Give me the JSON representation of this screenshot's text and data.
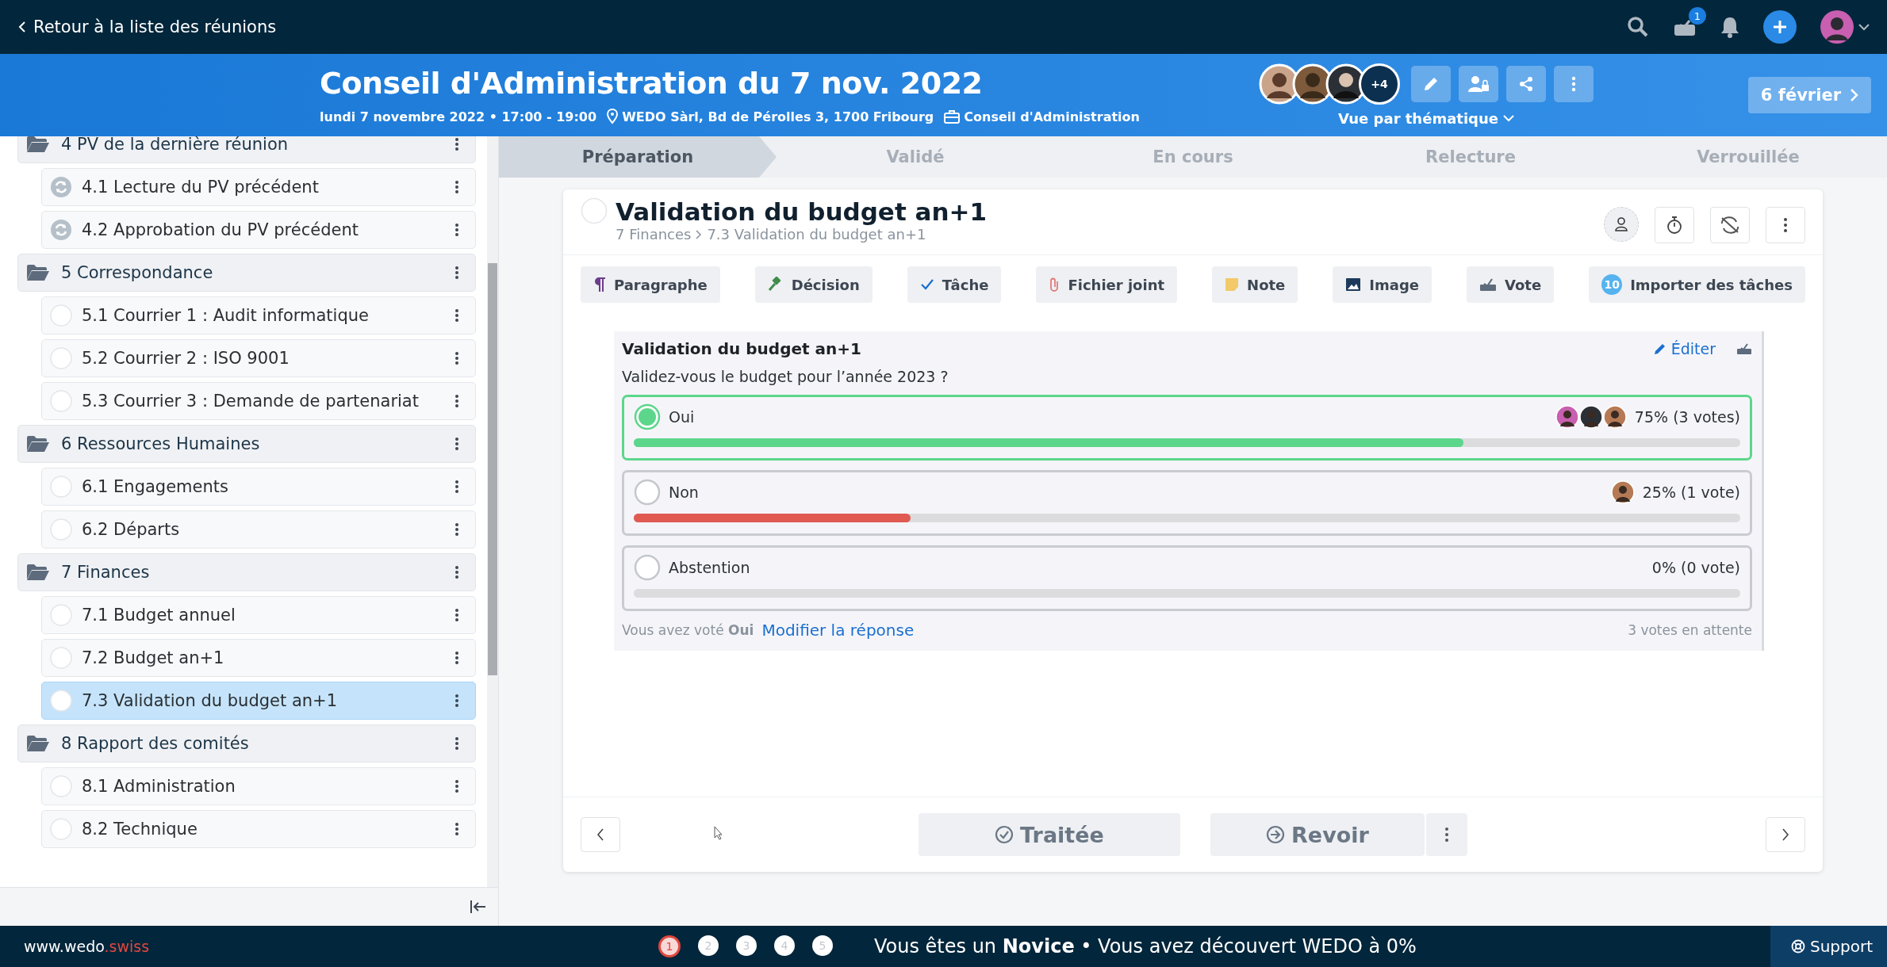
{
  "topbar": {
    "back_link": "Retour à la liste des réunions",
    "notification_badge": "1"
  },
  "meeting": {
    "title": "Conseil d'Administration du 7 nov. 2022",
    "date": "lundi 7 novembre 2022 • 17:00 - 19:00",
    "location": "WEDO Sàrl, Bd de Pérolles 3, 1700 Fribourg",
    "organization": "Conseil d'Administration",
    "participants_more": "+4",
    "view_selector": "Vue par thématique",
    "next_meeting": "6 février"
  },
  "sidebar": {
    "sections": [
      {
        "label": "4 PV de la dernière réunion",
        "children": [
          {
            "label": "4.1 Lecture du PV précédent",
            "kind": "recurring",
            "selected": false
          },
          {
            "label": "4.2 Approbation du PV précédent",
            "kind": "recurring",
            "selected": false
          }
        ]
      },
      {
        "label": "5 Correspondance",
        "children": [
          {
            "label": "5.1 Courrier 1 : Audit informatique",
            "kind": "open",
            "selected": false
          },
          {
            "label": "5.2 Courrier 2 : ISO 9001",
            "kind": "open",
            "selected": false
          },
          {
            "label": "5.3 Courrier 3 : Demande de partenariat",
            "kind": "open",
            "selected": false
          }
        ]
      },
      {
        "label": "6 Ressources Humaines",
        "children": [
          {
            "label": "6.1 Engagements",
            "kind": "open",
            "selected": false
          },
          {
            "label": "6.2 Départs",
            "kind": "open",
            "selected": false
          }
        ]
      },
      {
        "label": "7 Finances",
        "children": [
          {
            "label": "7.1 Budget annuel",
            "kind": "open",
            "selected": false
          },
          {
            "label": "7.2 Budget an+1",
            "kind": "open",
            "selected": false
          },
          {
            "label": "7.3 Validation du budget an+1",
            "kind": "open",
            "selected": true
          }
        ]
      },
      {
        "label": "8 Rapport des comités",
        "children": [
          {
            "label": "8.1 Administration",
            "kind": "open",
            "selected": false
          },
          {
            "label": "8.2 Technique",
            "kind": "open",
            "selected": false
          }
        ]
      }
    ]
  },
  "steps": [
    {
      "label": "Préparation",
      "selected": true
    },
    {
      "label": "Validé",
      "selected": false
    },
    {
      "label": "En cours",
      "selected": false
    },
    {
      "label": "Relecture",
      "selected": false
    },
    {
      "label": "Verrouillée",
      "selected": false
    }
  ],
  "topic": {
    "title": "Validation du budget an+1",
    "breadcrumb": [
      "7 Finances",
      "7.3 Validation du budget an+1"
    ],
    "tools": [
      {
        "label": "Paragraphe",
        "kind": "paragraph"
      },
      {
        "label": "Décision",
        "kind": "decision"
      },
      {
        "label": "Tâche",
        "kind": "task"
      },
      {
        "label": "Fichier joint",
        "kind": "attachment"
      },
      {
        "label": "Note",
        "kind": "note"
      },
      {
        "label": "Image",
        "kind": "image"
      },
      {
        "label": "Vote",
        "kind": "vote"
      },
      {
        "label": "Importer des tâches",
        "kind": "import",
        "count": "10"
      }
    ]
  },
  "vote": {
    "title": "Validation du budget an+1",
    "edit": "Éditer",
    "question": "Validez-vous le budget pour l’année 2023 ?",
    "options": [
      {
        "label": "Oui",
        "selected": true,
        "level": 0.75,
        "color": "#5cd68b",
        "result": "75% (3 votes)",
        "voters": [
          {
            "kind": "avatar"
          },
          {
            "kind": "avatar"
          },
          {
            "kind": "avatar"
          }
        ]
      },
      {
        "label": "Non",
        "selected": false,
        "level": 0.25,
        "color": "#e05a52",
        "result": "25% (1 vote)",
        "voters": [
          {
            "kind": "avatar"
          }
        ]
      },
      {
        "label": "Abstention",
        "selected": false,
        "level": 0,
        "color": "#cccccc",
        "result": "0% (0 vote)"
      }
    ],
    "my_vote": "Vous avez voté **Oui**",
    "change_link": "Modifier la réponse",
    "pending": "3 votes en attente"
  },
  "actions": {
    "done": "Traitée",
    "review": "Revoir"
  },
  "footer": {
    "site_name": "www.wedo",
    "site_suffix": ".swiss",
    "levels": [
      {
        "label": "1",
        "selected": true
      },
      {
        "label": "2",
        "selected": false
      },
      {
        "label": "3",
        "selected": false
      },
      {
        "label": "4",
        "selected": false
      },
      {
        "label": "5",
        "selected": false
      }
    ],
    "message": "Vous êtes un **Novice** • Vous avez découvert WEDO à 0%",
    "support": "Support"
  }
}
